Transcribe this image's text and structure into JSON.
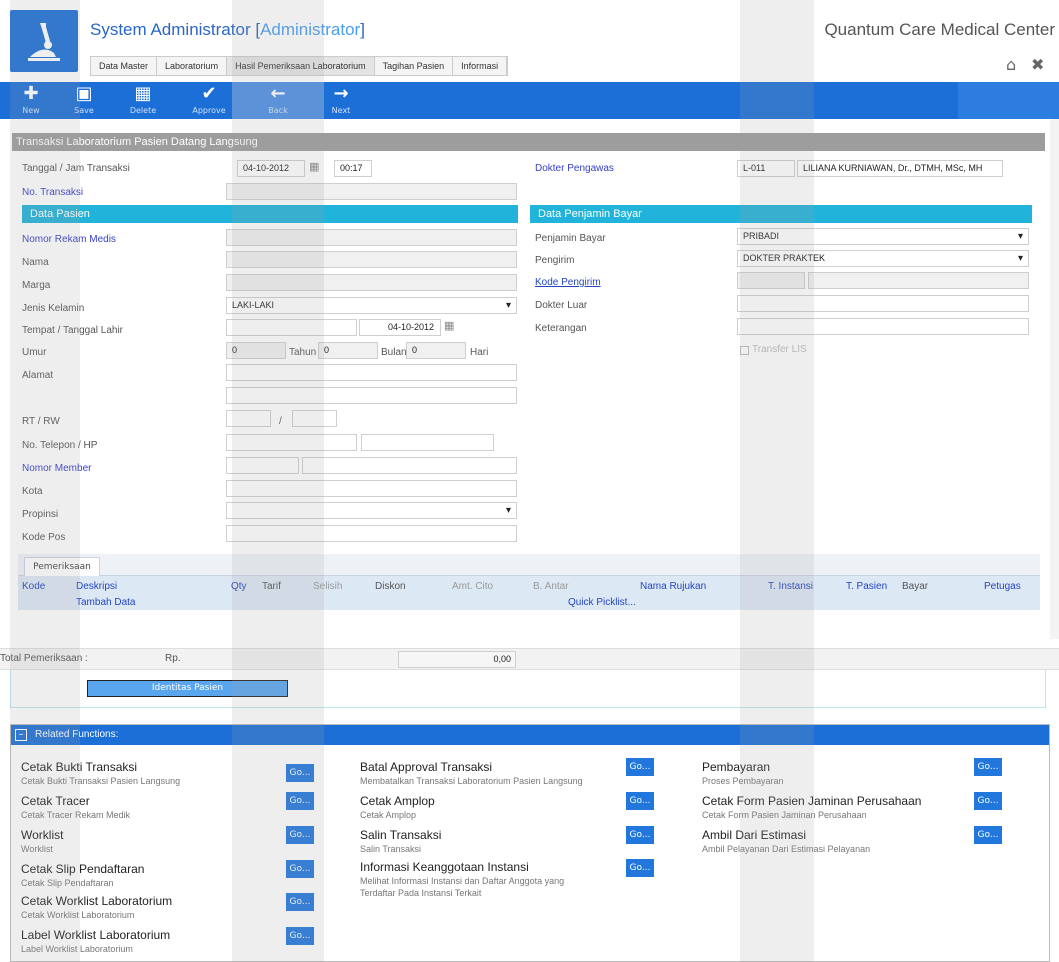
{
  "header": {
    "title_user": "System Administrator [",
    "title_role": "Administrator",
    "title_close": "]",
    "hospital": "Quantum Care Medical Center",
    "menu": [
      "Data Master",
      "Laboratorium",
      "Hasil Pemeriksaan Laboratorium",
      "Tagihan Pasien",
      "Informasi"
    ],
    "home_icon": "home-icon",
    "close_icon": "close-icon"
  },
  "toolbar": {
    "new": "New",
    "save": "Save",
    "delete": "Delete",
    "approve": "Approve",
    "back": "Back",
    "next": "Next"
  },
  "section_title": "Transaksi Laboratorium Pasien Datang Langsung",
  "transaksi": {
    "tanggal_label": "Tanggal / Jam Transaksi",
    "tanggal": "04-10-2012",
    "jam": "00:17",
    "no_label": "No. Transaksi",
    "dokter_label": "Dokter Pengawas",
    "dokter_kode": "L-011",
    "dokter_nama": "LILIANA KURNIAWAN, Dr., DTMH, MSc, MH"
  },
  "pasien": {
    "band": "Data Pasien",
    "rekam_medis": "Nomor Rekam Medis",
    "nama": "Nama",
    "marga": "Marga",
    "jenis_kelamin": "Jenis Kelamin",
    "jenis_kelamin_value": "LAKI-LAKI",
    "tempat_lahir": "Tempat / Tanggal Lahir",
    "tanggal_lahir": "04-10-2012",
    "umur": "Umur",
    "tahun_value": "0",
    "tahun": "Tahun",
    "bulan_value": "0",
    "bulan": "Bulan",
    "hari_value": "0",
    "hari": "Hari",
    "alamat": "Alamat",
    "rt_rw": "RT / RW",
    "rt_sep": "/",
    "telepon": "No. Telepon / HP",
    "member": "Nomor Member",
    "kota": "Kota",
    "propinsi": "Propinsi",
    "kode_pos": "Kode Pos"
  },
  "penjamin": {
    "band": "Data Penjamin Bayar",
    "penjamin_label": "Penjamin Bayar",
    "penjamin_value": "PRIBADI",
    "pengirim_label": "Pengirim",
    "pengirim_value": "DOKTER PRAKTEK",
    "kode_pengirim": "Kode Pengirim",
    "dokter_luar": "Dokter Luar",
    "keterangan": "Keterangan",
    "transfer_lis": "Transfer LIS"
  },
  "pemeriksaan": {
    "tab": "Pemeriksaan",
    "columns": [
      "Kode",
      "Deskripsi",
      "Qty",
      "Tarif",
      "Selisih",
      "Diskon",
      "Amt. Cito",
      "B. Antar",
      "Nama Rujukan",
      "T. Instansi",
      "T. Pasien",
      "Bayar",
      "Petugas"
    ],
    "tambah": "Tambah Data",
    "picklist": "Quick Picklist..."
  },
  "total": {
    "label": "Total Pemeriksaan :",
    "currency": "Rp.",
    "value": "0,00"
  },
  "identitas_button": "Identitas Pasien",
  "related": {
    "title": "Related Functions:",
    "go": "Go...",
    "col1": [
      {
        "title": "Cetak Bukti Transaksi",
        "desc": "Cetak Bukti Transaksi Pasien Langsung"
      },
      {
        "title": "Cetak Tracer",
        "desc": "Cetak Tracer Rekam Medik"
      },
      {
        "title": "Worklist",
        "desc": "Worklist"
      },
      {
        "title": "Cetak Slip Pendaftaran",
        "desc": "Cetak Slip Pendaftaran"
      },
      {
        "title": "Cetak Worklist Laboratorium",
        "desc": "Cetak Worklist Laboratorium"
      },
      {
        "title": "Label Worklist Laboratorium",
        "desc": "Label Worklist Laboratorium"
      }
    ],
    "col2": [
      {
        "title": "Batal Approval Transaksi",
        "desc": "Membatalkan Transaksi Laboratorium Pasien Langsung"
      },
      {
        "title": "Cetak Amplop",
        "desc": "Cetak Amplop"
      },
      {
        "title": "Salin Transaksi",
        "desc": "Salin Transaksi"
      },
      {
        "title": "Informasi Keanggotaan Instansi",
        "desc": "Melihat Informasi Instansi dan Daftar Anggota yang",
        "desc2": "Terdaftar Pada Instansi Terkait"
      }
    ],
    "col3": [
      {
        "title": "Pembayaran",
        "desc": "Proses Pembayaran"
      },
      {
        "title": "Cetak Form Pasien Jaminan Perusahaan",
        "desc": "Cetak Form Pasien Jaminan Perusahaan"
      },
      {
        "title": "Ambil Dari Estimasi",
        "desc": "Ambil Pelayanan Dari Estimasi Pelayanan"
      }
    ]
  },
  "colors": {
    "primary": "#1b6fd6",
    "band": "#21b3d9",
    "title_blue": "#2a66c8"
  }
}
